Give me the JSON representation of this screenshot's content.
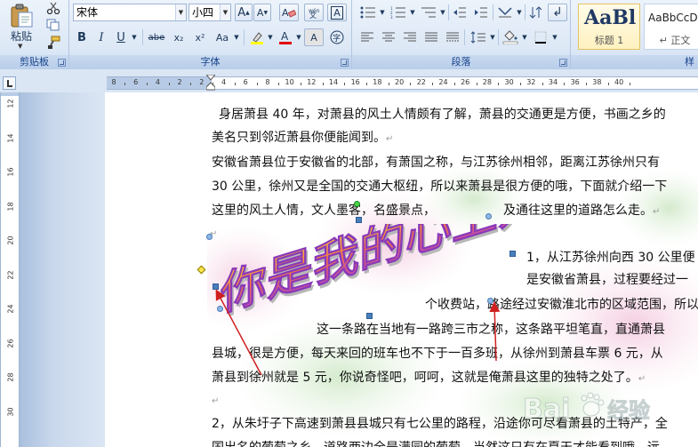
{
  "ribbon": {
    "clipboard": {
      "paste_label": "粘贴",
      "group_label": "剪贴板"
    },
    "font": {
      "font_name": "宋体",
      "font_size": "小四",
      "grow_label": "A",
      "shrink_label": "A",
      "clear_label": "A",
      "bold_label": "B",
      "italic_label": "I",
      "underline_label": "U",
      "strike_label": "abe",
      "subscript_label": "x₂",
      "superscript_label": "x²",
      "case_label": "Aa",
      "font_color_label": "A",
      "char_shading_label": "A",
      "group_label": "字体"
    },
    "paragraph": {
      "group_label": "段落"
    },
    "styles": {
      "style1_sample": "AaBl",
      "style1_name": "标题 1",
      "style2_sample": "AaBbCcD",
      "style2_name": "↵ 正文",
      "group_label": "样"
    }
  },
  "ruler": {
    "numbers": [
      "8",
      "6",
      "4",
      "2",
      "2",
      "4",
      "6",
      "8",
      "10",
      "12",
      "14",
      "16",
      "18",
      "20",
      "22",
      "24",
      "26",
      "28",
      "30",
      "32",
      "34",
      "36",
      "38",
      "40"
    ]
  },
  "vruler": {
    "numbers": [
      "12",
      "14",
      "16",
      "18",
      "20",
      "22",
      "24",
      "26",
      "28",
      "30"
    ]
  },
  "document": {
    "lines": [
      "身居萧县 40 年，对萧县的风土人情颇有了解，萧县的交通更是方便，书画之乡的",
      "美名只到邻近萧县你便能闻到。",
      "安徽省萧县位于安徽省的北部，有萧国之称，与江苏徐州相邻，距离江苏徐州只有",
      "30 公里，徐州又是全国的交通大枢纽，所以来萧县是很方便的哦，下面就介绍一下",
      "这里的风土人情，文人墨客，名盛景点，",
      "及通往这里的道路怎么走。",
      "1，从江苏徐州向西 30 公里便",
      "是安徽省萧县，过程要经过一",
      "个收费站，路途经过安徽淮北市的区域范围，所以",
      "这一条路在当地有一路跨三市之称，这条路平坦笔直，直通萧县",
      "县城，很是方便，每天来回的班车也不下于一百多班，从徐州到萧县车票 6 元，从",
      "萧县到徐州就是 5 元，你说奇怪吧，呵呵，这就是俺萧县这里的独特之处了。",
      "2，从朱圩子下高速到萧县县城只有七公里的路程，沿途你可尽看萧县的土特产，全",
      "国出名的葡萄之乡，道路两边全是满园的葡萄，当然这只有在夏天才能看到哦，远"
    ],
    "return_mark": "↵",
    "wordart_text": "你是我的心上人",
    "watermark_text": "Bai",
    "watermark_text2": "经验"
  },
  "colors": {
    "accent": "#15428b",
    "arrow_red": "#d01f1f",
    "font_color_bar": "#e00000",
    "highlight_bar": "#ffff00"
  }
}
